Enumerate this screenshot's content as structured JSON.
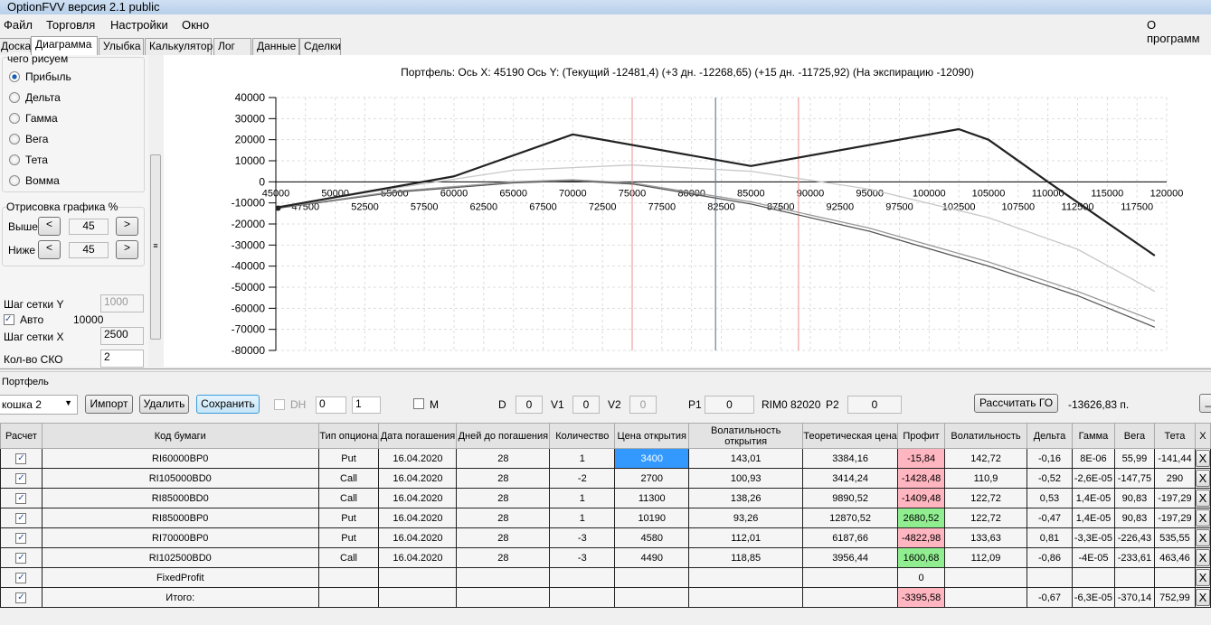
{
  "window": {
    "title": "OptionFVV версия 2.1 public"
  },
  "menu": [
    "Файл",
    "Торговля",
    "Настройки",
    "Окно"
  ],
  "menu_right": "О программ",
  "tabs": [
    "Доска",
    "Диаграмма",
    "Улыбка",
    "Калькулятор",
    "Лог",
    "Данные",
    "Сделки"
  ],
  "left": {
    "group_title": "чего рисуем",
    "radios": [
      "Прибыль",
      "Дельта",
      "Гамма",
      "Вега",
      "Тета",
      "Вомма"
    ],
    "draw_group": "Отрисовка графика %",
    "above_label": "Выше",
    "above_value": "45",
    "below_label": "Ниже",
    "below_value": "45",
    "prev": "<",
    "next": ">",
    "grid_y_label": "Шаг сетки Y",
    "grid_y_value": "1000",
    "auto_label": "Авто",
    "auto_value": "10000",
    "grid_x_label": "Шаг сетки X",
    "grid_x_value": "2500",
    "sko_label": "Кол-во СКО",
    "sko_value": "2"
  },
  "chart_data": {
    "type": "line",
    "title": "Портфель: Ось X: 45190  Ось Y:  (Текущий -12481,4)  (+3 дн. -12268,65)  (+15 дн. -11725,92)  (На экспирацию -12090)",
    "xlim": [
      45000,
      120000
    ],
    "ylim": [
      -80000,
      40000
    ],
    "yticks": [
      40000,
      30000,
      20000,
      10000,
      0,
      -10000,
      -20000,
      -30000,
      -40000,
      -50000,
      -60000,
      -70000,
      -80000
    ],
    "xticks_major": [
      45000,
      50000,
      55000,
      60000,
      65000,
      70000,
      75000,
      80000,
      85000,
      90000,
      95000,
      100000,
      105000,
      110000,
      115000,
      120000
    ],
    "xticks_minor": [
      47500,
      52500,
      57500,
      62500,
      67500,
      72500,
      77500,
      82500,
      87500,
      92500,
      97500,
      102500,
      107500,
      112500,
      117500
    ],
    "vlines": [
      {
        "x": 75000,
        "color": "#f4a0a0"
      },
      {
        "x": 82020,
        "color": "#6a7f99"
      },
      {
        "x": 89000,
        "color": "#f4a0a0"
      }
    ],
    "series": [
      {
        "name": "На экспирацию",
        "color": "#222222",
        "x": [
          45190,
          60000,
          70000,
          85000,
          102500,
          105000,
          110000,
          119000
        ],
        "y": [
          -12090,
          2600,
          22500,
          7500,
          25000,
          20000,
          0,
          -35000
        ]
      },
      {
        "name": "+15 дн.",
        "color": "#c8c8c8",
        "x": [
          45190,
          55000,
          65000,
          75000,
          85000,
          95000,
          105000,
          112500,
          119000
        ],
        "y": [
          -11726,
          -3000,
          5500,
          8000,
          5000,
          -3500,
          -17000,
          -32000,
          -52000
        ]
      },
      {
        "name": "+3 дн.",
        "color": "#999999",
        "x": [
          45190,
          55000,
          65000,
          70000,
          75000,
          85000,
          95000,
          105000,
          112500,
          119000
        ],
        "y": [
          -12269,
          -4500,
          0,
          1000,
          -500,
          -9500,
          -22000,
          -38000,
          -52000,
          -66000
        ]
      },
      {
        "name": "Текущий",
        "color": "#555555",
        "x": [
          45190,
          55000,
          65000,
          70000,
          75000,
          85000,
          95000,
          105000,
          112500,
          119000
        ],
        "y": [
          -12481,
          -5000,
          -500,
          500,
          -1000,
          -10500,
          -23500,
          -40000,
          -54000,
          -69000
        ]
      }
    ]
  },
  "portfolio": {
    "title": "Портфель",
    "name": "кошка 2",
    "import": "Импорт",
    "delete": "Удалить",
    "save": "Сохранить",
    "dh": "DH",
    "spin1": "0",
    "spin2": "1",
    "m": "M",
    "d_label": "D",
    "d": "0",
    "v1_label": "V1",
    "v1": "0",
    "v2_label": "V2",
    "v2": "0",
    "p1_label": "P1",
    "p1": "0",
    "rim": "RIM0 82020",
    "p2_label": "P2",
    "p2": "0",
    "calc_go": "Рассчитать ГО",
    "go_value": "-13626,83 п.",
    "min": "_"
  },
  "table": {
    "headers": [
      "Расчет",
      "Код бумаги",
      "Тип опциона",
      "Дата погашения",
      "Дней до погашения",
      "Количество",
      "Цена открытия",
      "Волатильность открытия",
      "Теоретическая цена",
      "Профит",
      "Волатильность",
      "Дельта",
      "Гамма",
      "Вега",
      "Тета",
      "X"
    ],
    "rows": [
      [
        "RI60000BP0",
        "Put",
        "16.04.2020",
        "28",
        "1",
        "3400",
        "143,01",
        "3384,16",
        "-15,84",
        "142,72",
        "-0,16",
        "8E-06",
        "55,99",
        "-141,44"
      ],
      [
        "RI105000BD0",
        "Call",
        "16.04.2020",
        "28",
        "-2",
        "2700",
        "100,93",
        "3414,24",
        "-1428,48",
        "110,9",
        "-0,52",
        "-2,6E-05",
        "-147,75",
        "290"
      ],
      [
        "RI85000BD0",
        "Call",
        "16.04.2020",
        "28",
        "1",
        "11300",
        "138,26",
        "9890,52",
        "-1409,48",
        "122,72",
        "0,53",
        "1,4E-05",
        "90,83",
        "-197,29"
      ],
      [
        "RI85000BP0",
        "Put",
        "16.04.2020",
        "28",
        "1",
        "10190",
        "93,26",
        "12870,52",
        "2680,52",
        "122,72",
        "-0,47",
        "1,4E-05",
        "90,83",
        "-197,29"
      ],
      [
        "RI70000BP0",
        "Put",
        "16.04.2020",
        "28",
        "-3",
        "4580",
        "112,01",
        "6187,66",
        "-4822,98",
        "133,63",
        "0,81",
        "-3,3E-05",
        "-226,43",
        "535,55"
      ],
      [
        "RI102500BD0",
        "Call",
        "16.04.2020",
        "28",
        "-3",
        "4490",
        "118,85",
        "3956,44",
        "1600,68",
        "112,09",
        "-0,86",
        "-4E-05",
        "-233,61",
        "463,46"
      ],
      [
        "FixedProfit",
        "",
        "",
        "",
        "",
        "",
        "",
        "",
        "0",
        "",
        "",
        "",
        "",
        ""
      ],
      [
        "Итого:",
        "",
        "",
        "",
        "",
        "",
        "",
        "",
        "-3395,58",
        "",
        "-0,67",
        "-6,3E-05",
        "-370,14",
        "752,99"
      ]
    ],
    "x_label": "X"
  }
}
